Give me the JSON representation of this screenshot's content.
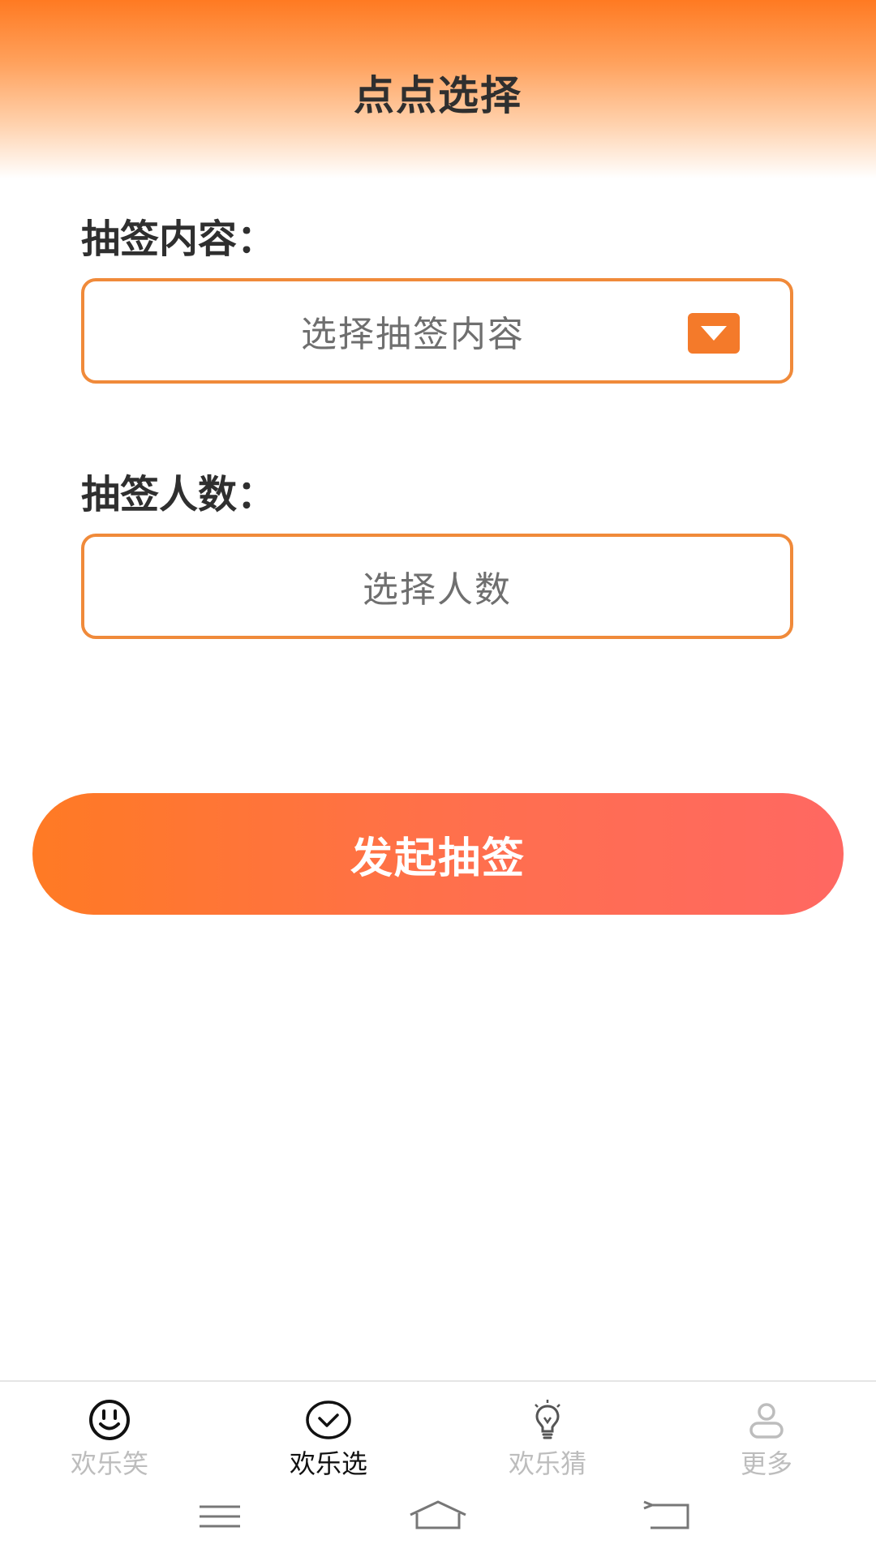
{
  "header": {
    "title": "点点选择"
  },
  "form": {
    "content_label": "抽签内容：",
    "content_placeholder": "选择抽签内容",
    "count_label": "抽签人数：",
    "count_placeholder": "选择人数",
    "submit_label": "发起抽签"
  },
  "tabbar": {
    "items": [
      {
        "label": "欢乐笑",
        "icon": "smiley-icon",
        "active": false
      },
      {
        "label": "欢乐选",
        "icon": "check-circle-icon",
        "active": true
      },
      {
        "label": "欢乐猜",
        "icon": "lightbulb-icon",
        "active": false
      },
      {
        "label": "更多",
        "icon": "user-icon",
        "active": false
      }
    ]
  },
  "system_nav": {
    "icons": [
      "menu-icon",
      "home-icon",
      "back-icon"
    ]
  },
  "colors": {
    "accent": "#f47a2a",
    "button_gradient_start": "#ff7a24",
    "button_gradient_end": "#ff6862",
    "active_tab": "#111111",
    "inactive_tab": "#bdbdbd"
  }
}
